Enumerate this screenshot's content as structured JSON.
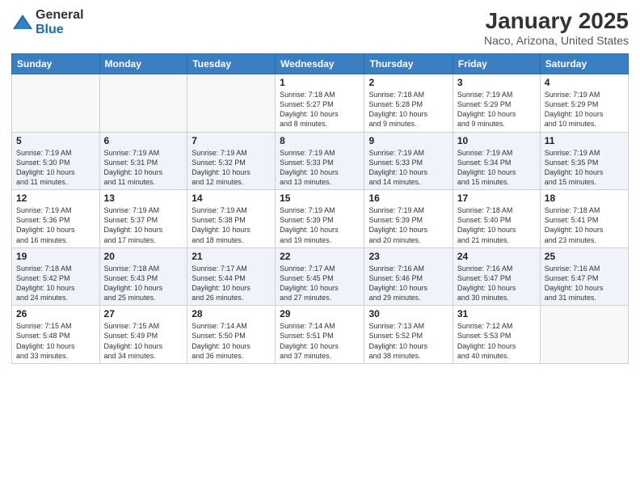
{
  "logo": {
    "general": "General",
    "blue": "Blue"
  },
  "title": "January 2025",
  "subtitle": "Naco, Arizona, United States",
  "weekdays": [
    "Sunday",
    "Monday",
    "Tuesday",
    "Wednesday",
    "Thursday",
    "Friday",
    "Saturday"
  ],
  "weeks": [
    [
      {
        "day": "",
        "info": ""
      },
      {
        "day": "",
        "info": ""
      },
      {
        "day": "",
        "info": ""
      },
      {
        "day": "1",
        "info": "Sunrise: 7:18 AM\nSunset: 5:27 PM\nDaylight: 10 hours\nand 8 minutes."
      },
      {
        "day": "2",
        "info": "Sunrise: 7:18 AM\nSunset: 5:28 PM\nDaylight: 10 hours\nand 9 minutes."
      },
      {
        "day": "3",
        "info": "Sunrise: 7:19 AM\nSunset: 5:29 PM\nDaylight: 10 hours\nand 9 minutes."
      },
      {
        "day": "4",
        "info": "Sunrise: 7:19 AM\nSunset: 5:29 PM\nDaylight: 10 hours\nand 10 minutes."
      }
    ],
    [
      {
        "day": "5",
        "info": "Sunrise: 7:19 AM\nSunset: 5:30 PM\nDaylight: 10 hours\nand 11 minutes."
      },
      {
        "day": "6",
        "info": "Sunrise: 7:19 AM\nSunset: 5:31 PM\nDaylight: 10 hours\nand 11 minutes."
      },
      {
        "day": "7",
        "info": "Sunrise: 7:19 AM\nSunset: 5:32 PM\nDaylight: 10 hours\nand 12 minutes."
      },
      {
        "day": "8",
        "info": "Sunrise: 7:19 AM\nSunset: 5:33 PM\nDaylight: 10 hours\nand 13 minutes."
      },
      {
        "day": "9",
        "info": "Sunrise: 7:19 AM\nSunset: 5:33 PM\nDaylight: 10 hours\nand 14 minutes."
      },
      {
        "day": "10",
        "info": "Sunrise: 7:19 AM\nSunset: 5:34 PM\nDaylight: 10 hours\nand 15 minutes."
      },
      {
        "day": "11",
        "info": "Sunrise: 7:19 AM\nSunset: 5:35 PM\nDaylight: 10 hours\nand 15 minutes."
      }
    ],
    [
      {
        "day": "12",
        "info": "Sunrise: 7:19 AM\nSunset: 5:36 PM\nDaylight: 10 hours\nand 16 minutes."
      },
      {
        "day": "13",
        "info": "Sunrise: 7:19 AM\nSunset: 5:37 PM\nDaylight: 10 hours\nand 17 minutes."
      },
      {
        "day": "14",
        "info": "Sunrise: 7:19 AM\nSunset: 5:38 PM\nDaylight: 10 hours\nand 18 minutes."
      },
      {
        "day": "15",
        "info": "Sunrise: 7:19 AM\nSunset: 5:39 PM\nDaylight: 10 hours\nand 19 minutes."
      },
      {
        "day": "16",
        "info": "Sunrise: 7:19 AM\nSunset: 5:39 PM\nDaylight: 10 hours\nand 20 minutes."
      },
      {
        "day": "17",
        "info": "Sunrise: 7:18 AM\nSunset: 5:40 PM\nDaylight: 10 hours\nand 21 minutes."
      },
      {
        "day": "18",
        "info": "Sunrise: 7:18 AM\nSunset: 5:41 PM\nDaylight: 10 hours\nand 23 minutes."
      }
    ],
    [
      {
        "day": "19",
        "info": "Sunrise: 7:18 AM\nSunset: 5:42 PM\nDaylight: 10 hours\nand 24 minutes."
      },
      {
        "day": "20",
        "info": "Sunrise: 7:18 AM\nSunset: 5:43 PM\nDaylight: 10 hours\nand 25 minutes."
      },
      {
        "day": "21",
        "info": "Sunrise: 7:17 AM\nSunset: 5:44 PM\nDaylight: 10 hours\nand 26 minutes."
      },
      {
        "day": "22",
        "info": "Sunrise: 7:17 AM\nSunset: 5:45 PM\nDaylight: 10 hours\nand 27 minutes."
      },
      {
        "day": "23",
        "info": "Sunrise: 7:16 AM\nSunset: 5:46 PM\nDaylight: 10 hours\nand 29 minutes."
      },
      {
        "day": "24",
        "info": "Sunrise: 7:16 AM\nSunset: 5:47 PM\nDaylight: 10 hours\nand 30 minutes."
      },
      {
        "day": "25",
        "info": "Sunrise: 7:16 AM\nSunset: 5:47 PM\nDaylight: 10 hours\nand 31 minutes."
      }
    ],
    [
      {
        "day": "26",
        "info": "Sunrise: 7:15 AM\nSunset: 5:48 PM\nDaylight: 10 hours\nand 33 minutes."
      },
      {
        "day": "27",
        "info": "Sunrise: 7:15 AM\nSunset: 5:49 PM\nDaylight: 10 hours\nand 34 minutes."
      },
      {
        "day": "28",
        "info": "Sunrise: 7:14 AM\nSunset: 5:50 PM\nDaylight: 10 hours\nand 36 minutes."
      },
      {
        "day": "29",
        "info": "Sunrise: 7:14 AM\nSunset: 5:51 PM\nDaylight: 10 hours\nand 37 minutes."
      },
      {
        "day": "30",
        "info": "Sunrise: 7:13 AM\nSunset: 5:52 PM\nDaylight: 10 hours\nand 38 minutes."
      },
      {
        "day": "31",
        "info": "Sunrise: 7:12 AM\nSunset: 5:53 PM\nDaylight: 10 hours\nand 40 minutes."
      },
      {
        "day": "",
        "info": ""
      }
    ]
  ]
}
